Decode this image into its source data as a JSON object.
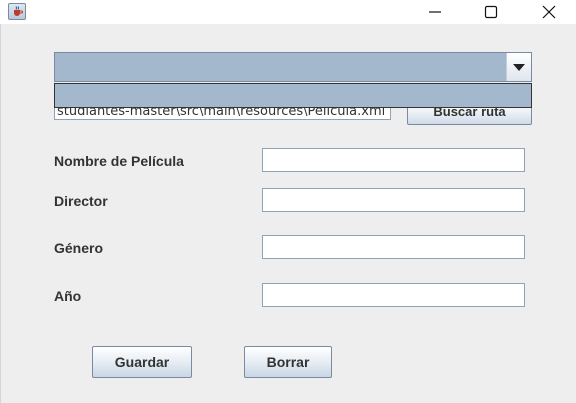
{
  "window": {
    "title": "",
    "icons": [
      "java-app-icon",
      "minimize-icon",
      "maximize-icon",
      "close-icon"
    ]
  },
  "file_selector": {
    "combo_value": "",
    "dropdown_item": "",
    "path_value": "studiantes-master\\src\\main\\resources\\Pelicula.xml",
    "browse_label": "Buscar ruta"
  },
  "form": {
    "fields": [
      {
        "label": "Nombre de Película",
        "value": ""
      },
      {
        "label": "Director",
        "value": ""
      },
      {
        "label": "Género",
        "value": ""
      },
      {
        "label": "Año",
        "value": ""
      }
    ]
  },
  "actions": {
    "save_label": "Guardar",
    "delete_label": "Borrar"
  },
  "colors": {
    "window_bg": "#eeeeee",
    "combo_selection": "#a3b8cc",
    "control_border": "#7a8aa0"
  }
}
